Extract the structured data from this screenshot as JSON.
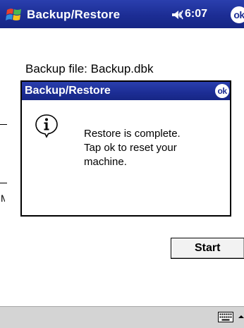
{
  "titlebar": {
    "title": "Backup/Restore",
    "time": "6:07",
    "ok_label": "ok",
    "icons": [
      "windows-flag-icon",
      "speaker-icon"
    ]
  },
  "main": {
    "backup_file_label": "Backup file: Backup.dbk",
    "truncated_label": "M",
    "start_button_label": "Start"
  },
  "dialog": {
    "title": "Backup/Restore",
    "ok_label": "ok",
    "icon": "info-icon",
    "message_line1": "Restore is complete.",
    "message_line2": "Tap ok to reset your",
    "message_line3": "machine."
  },
  "bottombar": {
    "icons": [
      "keyboard-icon",
      "input-panel-arrow-icon"
    ]
  },
  "colors": {
    "titlebar": "#1c2d94",
    "bottombar": "#d4d4d4",
    "background": "#ffffff"
  }
}
